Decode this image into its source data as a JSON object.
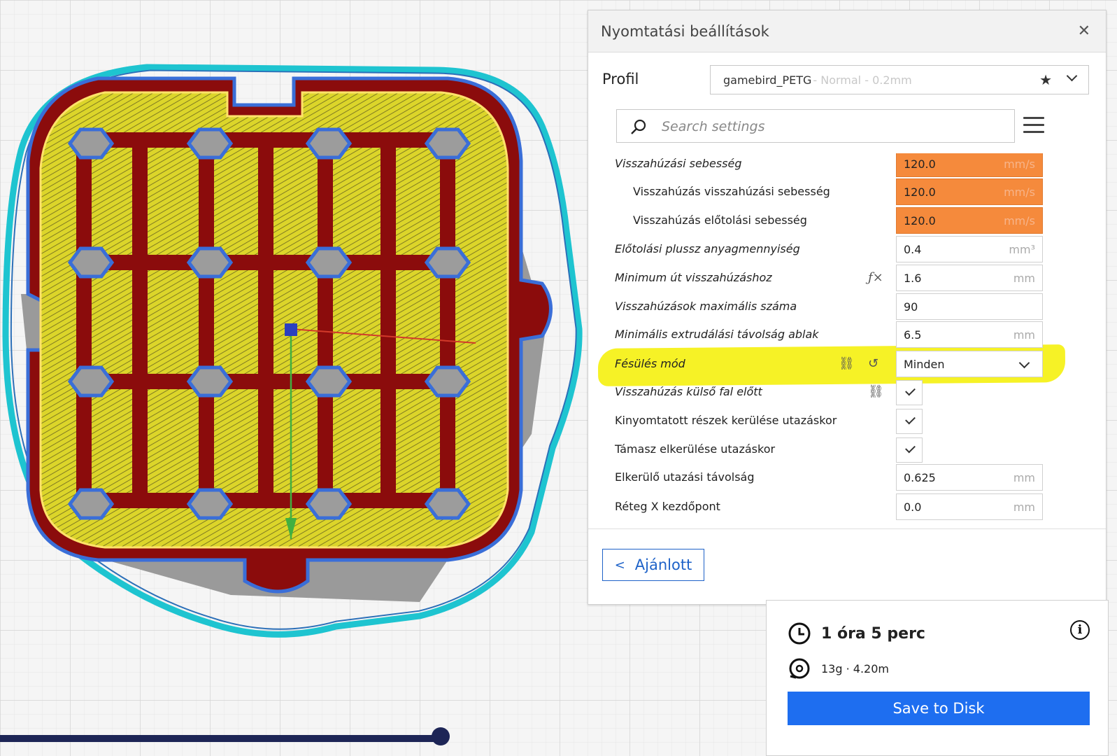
{
  "panel": {
    "title": "Nyomtatási beállítások",
    "close_icon": "close-icon"
  },
  "profile": {
    "label": "Profil",
    "name": "gamebird_PETG",
    "sub": " - Normal - 0.2mm",
    "star_icon": "star-icon",
    "chevron_icon": "chevron-down-icon"
  },
  "search": {
    "placeholder": "Search settings"
  },
  "settings": [
    {
      "label": "Visszahúzási sebesség",
      "value": "120.0",
      "unit": "mm/s"
    },
    {
      "label": "Visszahúzás visszahúzási sebesség",
      "value": "120.0",
      "unit": "mm/s"
    },
    {
      "label": "Visszahúzás előtolási sebesség",
      "value": "120.0",
      "unit": "mm/s"
    },
    {
      "label": "Előtolási plussz anyagmennyiség",
      "value": "0.4",
      "unit": "mm³"
    },
    {
      "label": "Minimum út visszahúzáshoz",
      "value": "1.6",
      "unit": "mm",
      "icon": "fx-icon"
    },
    {
      "label": "Visszahúzások maximális száma",
      "value": "90",
      "unit": ""
    },
    {
      "label": "Minimális extrudálási távolság ablak",
      "value": "6.5",
      "unit": "mm"
    },
    {
      "label": "Fésülés mód",
      "value": "Minden",
      "type": "dropdown"
    },
    {
      "label": "Visszahúzás külső fal előtt",
      "checked": true
    },
    {
      "label": "Kinyomtatott részek kerülése utazáskor",
      "checked": true
    },
    {
      "label": "Támasz elkerülése utazáskor",
      "checked": true
    },
    {
      "label": "Elkerülő utazási távolság",
      "value": "0.625",
      "unit": "mm"
    },
    {
      "label": "Réteg X kezdőpont",
      "value": "0.0",
      "unit": "mm"
    }
  ],
  "footer": {
    "back_label": "Ajánlott"
  },
  "print": {
    "time": "1 óra 5 perc",
    "material": "13g · 4.20m",
    "save_label": "Save to Disk"
  },
  "colors": {
    "accent": "#1e6ef0",
    "orange_field": "#f58a3c",
    "highlight": "#f5f000",
    "wall_red": "#8b0c0c",
    "infill_yellow": "#d6d02a",
    "skirt_cyan": "#1ec4d0"
  }
}
